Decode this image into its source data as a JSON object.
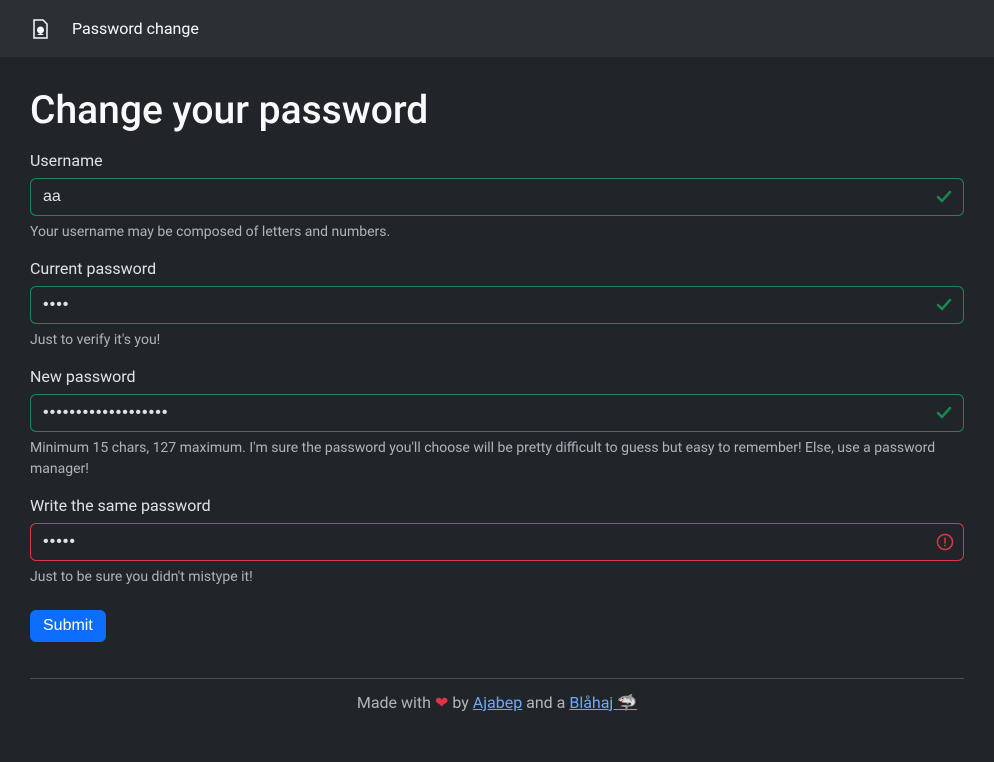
{
  "navbar": {
    "title": "Password change"
  },
  "page": {
    "heading": "Change your password"
  },
  "form": {
    "username": {
      "label": "Username",
      "value": "aa",
      "help": "Your username may be composed of letters and numbers.",
      "valid": true
    },
    "currentPassword": {
      "label": "Current password",
      "value": "••••",
      "help": "Just to verify it's you!",
      "valid": true
    },
    "newPassword": {
      "label": "New password",
      "value": "•••••••••••••••••••",
      "help": "Minimum 15 chars, 127 maximum. I'm sure the password you'll choose will be pretty difficult to guess but easy to remember! Else, use a password manager!",
      "valid": true
    },
    "confirmPassword": {
      "label": "Write the same password",
      "value": "•••••",
      "help": "Just to be sure you didn't mistype it!",
      "valid": false
    },
    "submit": {
      "label": "Submit"
    }
  },
  "footer": {
    "prefix": "Made with ",
    "heart": "❤",
    "by": " by ",
    "author": "Ajabep",
    "and": " and a ",
    "blahaj": "Blåhaj ",
    "shark": "🦈"
  },
  "colors": {
    "valid": "#198754",
    "invalid": "#dc3545",
    "primary": "#0d6efd"
  }
}
